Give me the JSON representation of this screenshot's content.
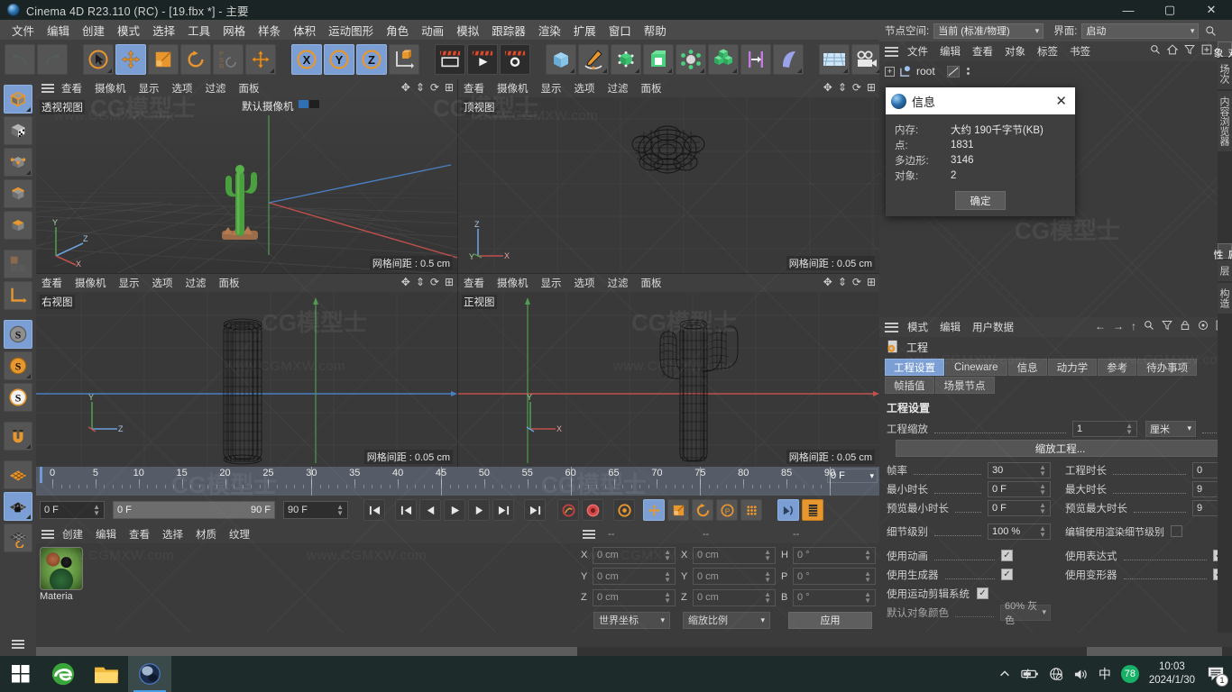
{
  "titlebar": {
    "title": "Cinema 4D R23.110 (RC) - [19.fbx *] - 主要",
    "minimize": "—",
    "maximize": "▢",
    "close": "✕"
  },
  "menubar": {
    "items": [
      "文件",
      "编辑",
      "创建",
      "模式",
      "选择",
      "工具",
      "网格",
      "样条",
      "体积",
      "运动图形",
      "角色",
      "动画",
      "模拟",
      "跟踪器",
      "渲染",
      "扩展",
      "窗口",
      "帮助"
    ]
  },
  "topright": {
    "node_space_label": "节点空间:",
    "node_space_value": "当前 (标准/物理)",
    "layout_label": "界面:",
    "layout_value": "启动"
  },
  "object_manager": {
    "menu": [
      "文件",
      "编辑",
      "查看",
      "对象",
      "标签",
      "书签"
    ],
    "root_item": "root"
  },
  "attribute_manager": {
    "menu": [
      "模式",
      "编辑",
      "用户数据"
    ],
    "object_title": "工程",
    "tabs": [
      "工程设置",
      "Cineware",
      "信息",
      "动力学",
      "参考",
      "待办事项",
      "帧插值",
      "场景节点"
    ],
    "selected_tab": "工程设置",
    "section_title": "工程设置",
    "fields": {
      "project_scale_label": "工程缩放",
      "project_scale_value": "1",
      "project_scale_unit": "厘米",
      "scale_project_button": "缩放工程...",
      "fps_label": "帧率",
      "fps_value": "30",
      "project_length_label": "工程时长",
      "project_length_value": "0",
      "min_time_label": "最小时长",
      "min_time_value": "0 F",
      "max_time_label": "最大时长",
      "max_time_value": "9",
      "preview_min_label": "预览最小时长",
      "preview_min_value": "0 F",
      "preview_max_label": "预览最大时长",
      "preview_max_value": "9",
      "lod_label": "细节级别",
      "lod_value": "100 %",
      "render_lod_label": "编辑使用渲染细节级别",
      "use_animation_label": "使用动画",
      "use_expression_label": "使用表达式",
      "use_generator_label": "使用生成器",
      "use_deformer_label": "使用变形器",
      "use_motionclip_label": "使用运动剪辑系统",
      "bg_color_label": "默认对象颜色",
      "bg_color_value": "60% 灰色"
    }
  },
  "side_tabs": {
    "top": [
      "对象",
      "场次",
      "内容浏览器"
    ],
    "bottom": [
      "属性",
      "层",
      "构造"
    ]
  },
  "info_dialog": {
    "title": "信息",
    "close": "✕",
    "rows": [
      {
        "key": "内存:",
        "value": "大约 190千字节(KB)"
      },
      {
        "key": "点:",
        "value": "1831"
      },
      {
        "key": "多边形:",
        "value": "3146"
      },
      {
        "key": "对象:",
        "value": "2"
      }
    ],
    "ok_button": "确定"
  },
  "viewports": {
    "menu": [
      "查看",
      "摄像机",
      "显示",
      "选项",
      "过滤",
      "面板"
    ],
    "panes": [
      {
        "name": "透视视图",
        "camera": "默认摄像机",
        "grid": "网格间距 : 0.5 cm"
      },
      {
        "name": "顶视图",
        "camera": "",
        "grid": "网格间距 : 0.05 cm"
      },
      {
        "name": "右视图",
        "camera": "",
        "grid": "网格间距 : 0.05 cm"
      },
      {
        "name": "正视图",
        "camera": "",
        "grid": "网格间距 : 0.05 cm"
      }
    ]
  },
  "timeline": {
    "ticks": [
      0,
      5,
      10,
      15,
      20,
      25,
      30,
      35,
      40,
      45,
      50,
      55,
      60,
      65,
      70,
      75,
      80,
      85,
      90
    ],
    "current_frame_field": "0 F",
    "current_frame_box": "0 F",
    "range_start": "0 F",
    "range_end": "90 F",
    "range_max_field": "90 F"
  },
  "material_manager": {
    "menu": [
      "创建",
      "编辑",
      "查看",
      "选择",
      "材质",
      "纹理"
    ],
    "material_name": "Materia"
  },
  "coordinates": {
    "headers": [
      "--",
      "--",
      "--"
    ],
    "position": [
      {
        "axis": "X",
        "value": "0 cm"
      },
      {
        "axis": "Y",
        "value": "0 cm"
      },
      {
        "axis": "Z",
        "value": "0 cm"
      }
    ],
    "size": [
      {
        "axis": "X",
        "value": "0 cm"
      },
      {
        "axis": "Y",
        "value": "0 cm"
      },
      {
        "axis": "Z",
        "value": "0 cm"
      }
    ],
    "rotation": [
      {
        "axis": "H",
        "value": "0 °"
      },
      {
        "axis": "P",
        "value": "0 °"
      },
      {
        "axis": "B",
        "value": "0 °"
      }
    ],
    "coord_system": "世界坐标",
    "scale_mode": "缩放比例",
    "apply_button": "应用"
  },
  "taskbar": {
    "time": "10:03",
    "date": "2024/1/30",
    "ime": "中",
    "badge_count": "78",
    "notification_count": "1"
  },
  "watermarks": {
    "text": "www.CGMXW.com",
    "brand": "CG模型士"
  },
  "colors": {
    "accent_blue": "#7b9fd4",
    "orange": "#e8962e",
    "panel_bg": "#3b3b3b",
    "toolbar_bg": "#3f3f3f",
    "menu_bg": "#4a4a4a",
    "axis_x": "#d05050",
    "axis_y": "#50c050",
    "axis_z": "#5080d0"
  }
}
